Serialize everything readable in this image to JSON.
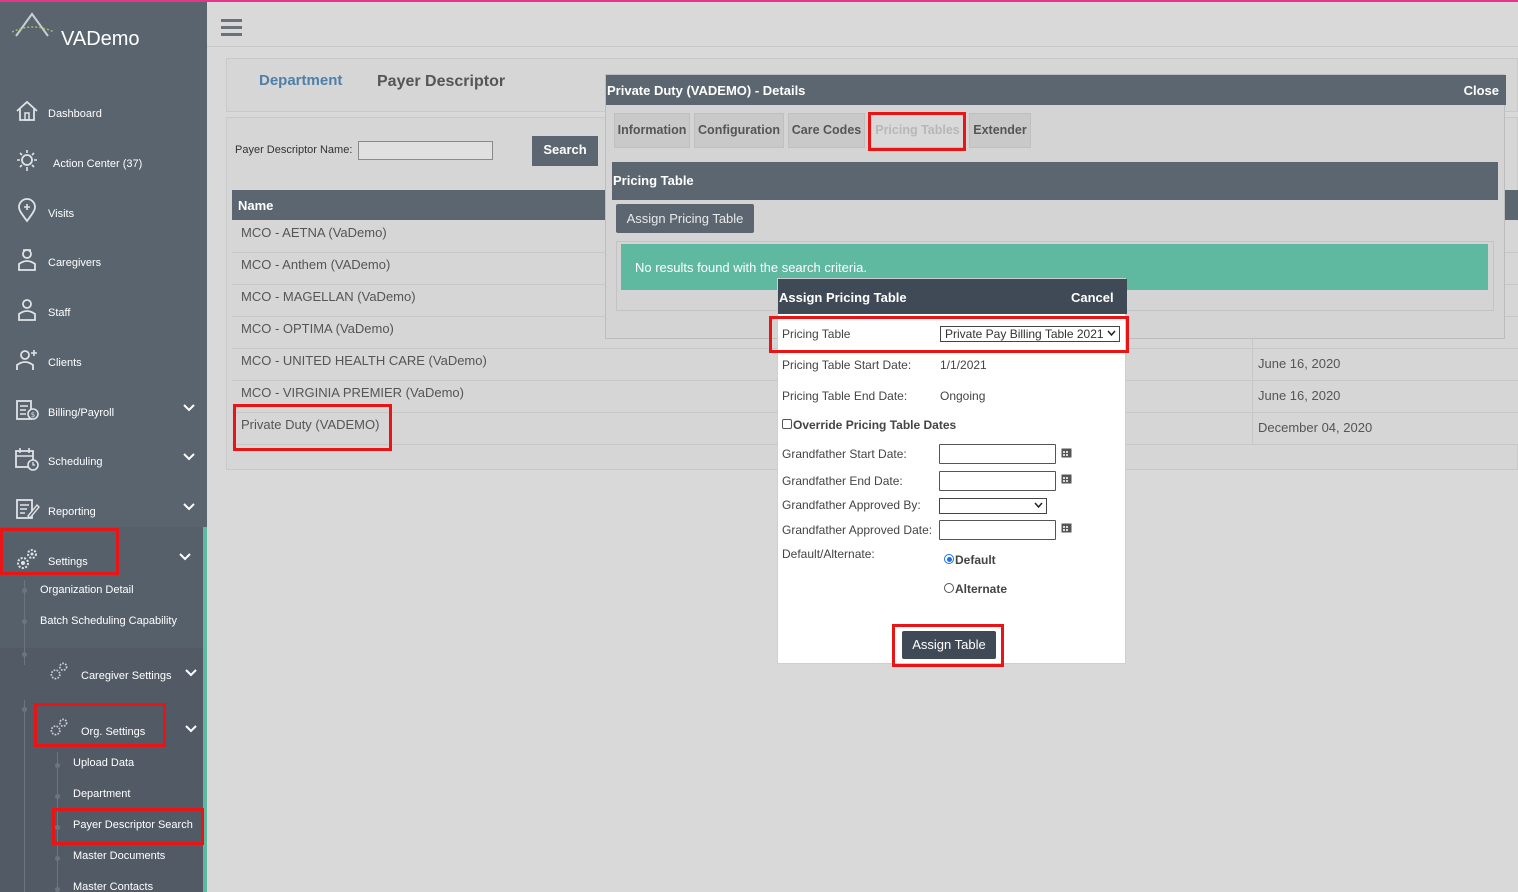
{
  "app": {
    "brand_name": "VADemo"
  },
  "sidebar": {
    "items": [
      {
        "label": "Dashboard",
        "icon": "home-icon"
      },
      {
        "label": "Action Center (37)",
        "icon": "bulb-icon"
      },
      {
        "label": "Visits",
        "icon": "map-pin-icon"
      },
      {
        "label": "Caregivers",
        "icon": "caregiver-icon"
      },
      {
        "label": "Staff",
        "icon": "staff-icon"
      },
      {
        "label": "Clients",
        "icon": "clients-icon"
      },
      {
        "label": "Billing/Payroll",
        "icon": "billing-icon"
      },
      {
        "label": "Scheduling",
        "icon": "calendar-clock-icon"
      },
      {
        "label": "Reporting",
        "icon": "report-icon"
      },
      {
        "label": "Settings",
        "icon": "gears-icon"
      }
    ],
    "settings_sub": {
      "organization_detail": "Organization Detail",
      "batch_scheduling": "Batch Scheduling Capability",
      "caregiver_settings": "Caregiver Settings",
      "org_settings": "Org. Settings",
      "org_sub": [
        "Upload Data",
        "Department",
        "Payer Descriptor Search",
        "Master Documents",
        "Master Contacts"
      ]
    }
  },
  "page": {
    "tabs": {
      "department": "Department",
      "payer_descriptor": "Payer Descriptor"
    },
    "search": {
      "label": "Payer Descriptor Name:",
      "value": "",
      "button": "Search"
    },
    "table": {
      "column_name": "Name",
      "rows": [
        {
          "name": "MCO - AETNA (VaDemo)",
          "date": ""
        },
        {
          "name": "MCO - Anthem (VADemo)",
          "date": ""
        },
        {
          "name": "MCO - MAGELLAN (VaDemo)",
          "date": ""
        },
        {
          "name": "MCO - OPTIMA (VaDemo)",
          "date": ""
        },
        {
          "name": "MCO - UNITED HEALTH CARE (VaDemo)",
          "date": "June 16, 2020"
        },
        {
          "name": "MCO - VIRGINIA PREMIER (VaDemo)",
          "date": "June 16, 2020"
        },
        {
          "name": "Private Duty (VADEMO)",
          "date": "December 04, 2020"
        }
      ]
    }
  },
  "details": {
    "title": "Private Duty (VADEMO) - Details",
    "close": "Close",
    "tabs": [
      "Information",
      "Configuration",
      "Care Codes",
      "Pricing Tables",
      "Extender"
    ],
    "section_title": "Pricing Table",
    "assign_button": "Assign Pricing Table",
    "no_results": "No results found with the search criteria."
  },
  "assign_modal": {
    "title": "Assign Pricing Table",
    "cancel": "Cancel",
    "pricing_table_label": "Pricing Table",
    "pricing_table_value": "Private Pay Billing Table 2021",
    "start_label": "Pricing Table Start Date:",
    "start_value": "1/1/2021",
    "end_label": "Pricing Table End Date:",
    "end_value": "Ongoing",
    "override_label": "Override Pricing Table Dates",
    "gf_start_label": "Grandfather Start Date:",
    "gf_end_label": "Grandfather End Date:",
    "gf_approved_by_label": "Grandfather Approved By:",
    "gf_approved_date_label": "Grandfather Approved Date:",
    "default_alt_label": "Default/Alternate:",
    "default_option": "Default",
    "alternate_option": "Alternate",
    "assign_button": "Assign Table"
  },
  "colors": {
    "sidebar_bg": "#5a646e",
    "header_bg": "#5c6670",
    "modal_header_bg": "#3f4a56",
    "success_bg": "#5fb9a1",
    "highlight": "#e81416",
    "accent_top": "#e4358b"
  }
}
